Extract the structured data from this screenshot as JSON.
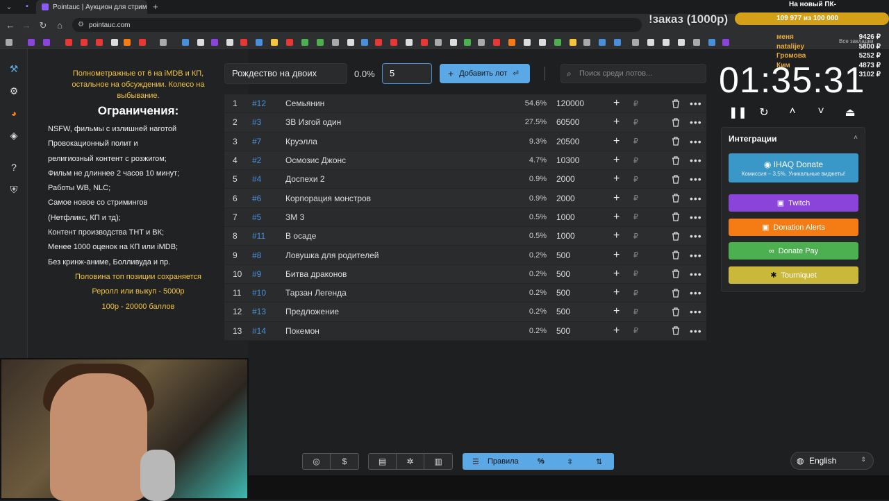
{
  "browser": {
    "tab_title": "Pointauc | Аукцион для стрим",
    "url": "pointauc.com",
    "all_bookmarks": "Все закладки"
  },
  "overlay": {
    "order_text": "!заказ (1000р)",
    "goal_title": "На новый ПК-",
    "goal_progress": "109 977 из 100 000",
    "donors": [
      {
        "name": "меня",
        "amount": "9426 ₽"
      },
      {
        "name": "natalijey",
        "amount": "5800 ₽"
      },
      {
        "name": "Громова",
        "amount": "5252 ₽"
      },
      {
        "name": "Ким",
        "amount": "4873 ₽"
      },
      {
        "name": "",
        "amount": "3102 ₽"
      }
    ]
  },
  "rules": {
    "top_note": "Полнометражные от 6 на iMDB и КП, остальное на обсуждении. Колесо на выбывание.",
    "heading": "Ограничения:",
    "items": [
      "NSFW, фильмы с излишней наготой",
      "Провокационный полит и",
      "религиозный контент с розжигом;",
      "Фильм не длиннее 2 часов 10 минут;",
      "Работы WB, NLC;",
      "Самое новое со стримингов",
      "(Нетфликс, КП и тд);",
      "Контент производства ТНТ и ВК;",
      "Менее 1000 оценок на КП или iMDB;",
      "Без кринж-аниме, Болливуда и пр."
    ],
    "footer": [
      "Половина топ позиции сохраняется",
      "Реролл или выкуп - 5000р",
      "100р - 20000 баллов"
    ]
  },
  "form": {
    "name_value": "Рождество на двоих",
    "percent": "0.0%",
    "amount_value": "5",
    "add_button": "Добавить лот",
    "search_placeholder": "Поиск среди лотов..."
  },
  "lots": [
    {
      "n": "1",
      "id": "#12",
      "name": "Семьянин",
      "pct": "54.6%",
      "amount": "120000"
    },
    {
      "n": "2",
      "id": "#3",
      "name": "ЗВ Изгой один",
      "pct": "27.5%",
      "amount": "60500"
    },
    {
      "n": "3",
      "id": "#7",
      "name": "Круэлла",
      "pct": "9.3%",
      "amount": "20500"
    },
    {
      "n": "4",
      "id": "#2",
      "name": "Осмозис Джонс",
      "pct": "4.7%",
      "amount": "10300"
    },
    {
      "n": "5",
      "id": "#4",
      "name": "Доспехи 2",
      "pct": "0.9%",
      "amount": "2000"
    },
    {
      "n": "6",
      "id": "#6",
      "name": "Корпорация монстров",
      "pct": "0.9%",
      "amount": "2000"
    },
    {
      "n": "7",
      "id": "#5",
      "name": "ЗМ 3",
      "pct": "0.5%",
      "amount": "1000"
    },
    {
      "n": "8",
      "id": "#11",
      "name": "В осаде",
      "pct": "0.5%",
      "amount": "1000"
    },
    {
      "n": "9",
      "id": "#8",
      "name": "Ловушка для родителей",
      "pct": "0.2%",
      "amount": "500"
    },
    {
      "n": "10",
      "id": "#9",
      "name": "Битва драконов",
      "pct": "0.2%",
      "amount": "500"
    },
    {
      "n": "11",
      "id": "#10",
      "name": "Тарзан Легенда",
      "pct": "0.2%",
      "amount": "500"
    },
    {
      "n": "12",
      "id": "#13",
      "name": "Предложение",
      "pct": "0.2%",
      "amount": "500"
    },
    {
      "n": "13",
      "id": "#14",
      "name": "Покемон",
      "pct": "0.2%",
      "amount": "500"
    }
  ],
  "currency_symbol": "₽",
  "timer": "01:35:31",
  "integrations": {
    "title": "Интеграции",
    "buttons": [
      {
        "label": "IHAQ Donate",
        "sub": "Комиссия – 3,5%. Уникальные виджеты!",
        "color": "#3a98c9"
      },
      {
        "label": "Twitch",
        "sub": "",
        "color": "#8b44d9"
      },
      {
        "label": "Donation Alerts",
        "sub": "",
        "color": "#f57c14"
      },
      {
        "label": "Donate Pay",
        "sub": "",
        "color": "#4caf50"
      },
      {
        "label": "Tourniquet",
        "sub": "",
        "color": "#c9b83a"
      }
    ]
  },
  "bottom": {
    "rules_label": "Правила",
    "language": "English"
  }
}
